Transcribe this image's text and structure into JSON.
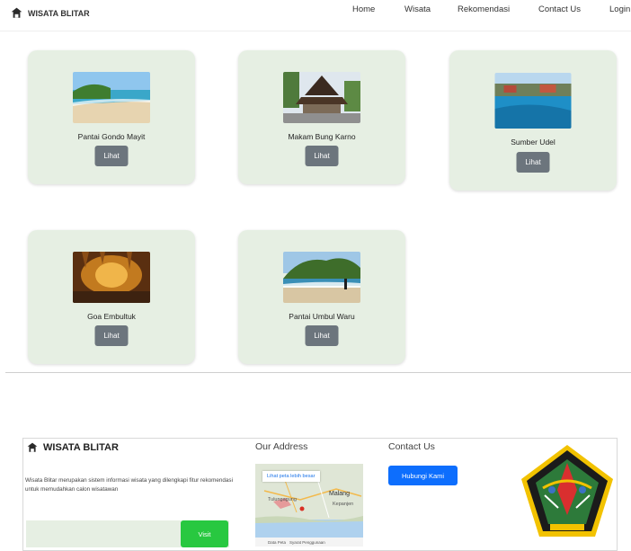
{
  "navbar": {
    "brand": "WISATA BLITAR",
    "links": [
      "Home",
      "Wisata",
      "Rekomendasi",
      "Contact Us",
      "Login"
    ]
  },
  "cards": [
    {
      "title": "Pantai Gondo Mayit",
      "button": "Lihat",
      "image": "beach-photo"
    },
    {
      "title": "Makam Bung Karno",
      "button": "Lihat",
      "image": "pavilion-photo"
    },
    {
      "title": "Sumber Udel",
      "button": "Lihat",
      "image": "pool-photo"
    },
    {
      "title": "Goa Embultuk",
      "button": "Lihat",
      "image": "cave-photo"
    },
    {
      "title": "Pantai Umbul Waru",
      "button": "Lihat",
      "image": "beach-cliff-photo"
    }
  ],
  "footer": {
    "brand": "WISATA BLITAR",
    "description": "Wisata Blitar merupakan sistem informasi wisata yang dilengkapi fitur rekomendasi untuk memudahkan calon wisatawan",
    "visit_button": "Visit",
    "address_heading": "Our Address",
    "map": {
      "link": "Lihat peta lebih besar",
      "labels": [
        "Malang",
        "Tulungagung",
        "Kepanjen"
      ],
      "footer_items": [
        "Data Peta",
        "Syarat Penggunaan"
      ]
    },
    "contact_heading": "Contact Us",
    "contact_button": "Hubungi Kami",
    "logo": "kabupaten-blitar-emblem"
  },
  "colors": {
    "card_bg": "#e6efe3",
    "button_gray": "#6c757d",
    "visit_green": "#28c840",
    "contact_blue": "#0d6efd"
  }
}
